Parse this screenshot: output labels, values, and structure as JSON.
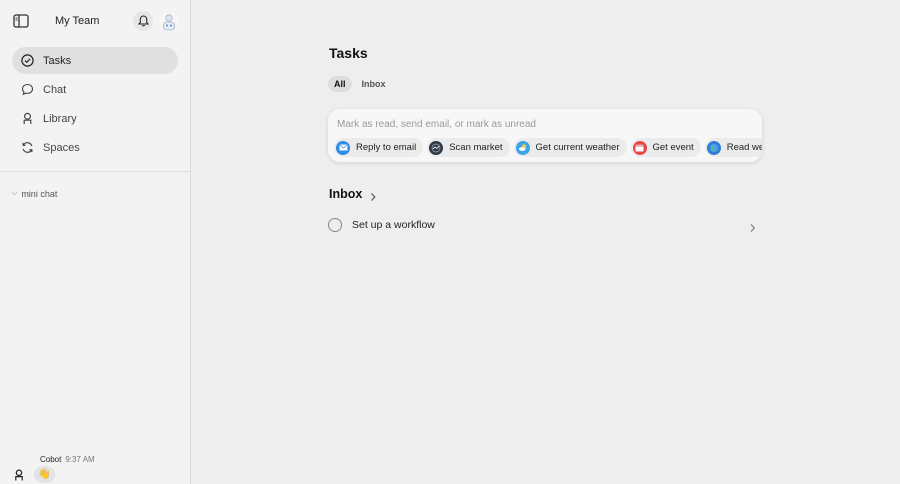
{
  "sidebar": {
    "title": "My Team",
    "nav": [
      {
        "label": "Tasks",
        "icon": "check-circle-icon",
        "active": true
      },
      {
        "label": "Chat",
        "icon": "chat-bubble-icon"
      },
      {
        "label": "Library",
        "icon": "person-icon"
      },
      {
        "label": "Spaces",
        "icon": "refresh-icon"
      }
    ],
    "mini_chat_label": "mini chat",
    "footer": {
      "sender": "Cobot",
      "time": "9:37 AM",
      "message": "👋"
    }
  },
  "main": {
    "title": "Tasks",
    "tabs": [
      {
        "label": "All",
        "active": true
      },
      {
        "label": "Inbox"
      }
    ],
    "composer": {
      "placeholder": "Mark as read, send email, or mark as unread",
      "chips": [
        {
          "label": "Reply to email",
          "icon": "mail-icon",
          "color": "#2b8be6"
        },
        {
          "label": "Scan market",
          "icon": "globe-dark-icon",
          "color": "#2f3a45"
        },
        {
          "label": "Get current weather",
          "icon": "weather-icon",
          "color": "#3aa5e8"
        },
        {
          "label": "Get event",
          "icon": "calendar-icon",
          "color": "#e24a4a",
          "glyph": "17"
        },
        {
          "label": "Read web page",
          "icon": "globe-icon",
          "color": "#2f7fd8"
        }
      ]
    },
    "inbox": {
      "heading": "Inbox",
      "tasks": [
        {
          "label": "Set up a workflow"
        }
      ]
    }
  }
}
